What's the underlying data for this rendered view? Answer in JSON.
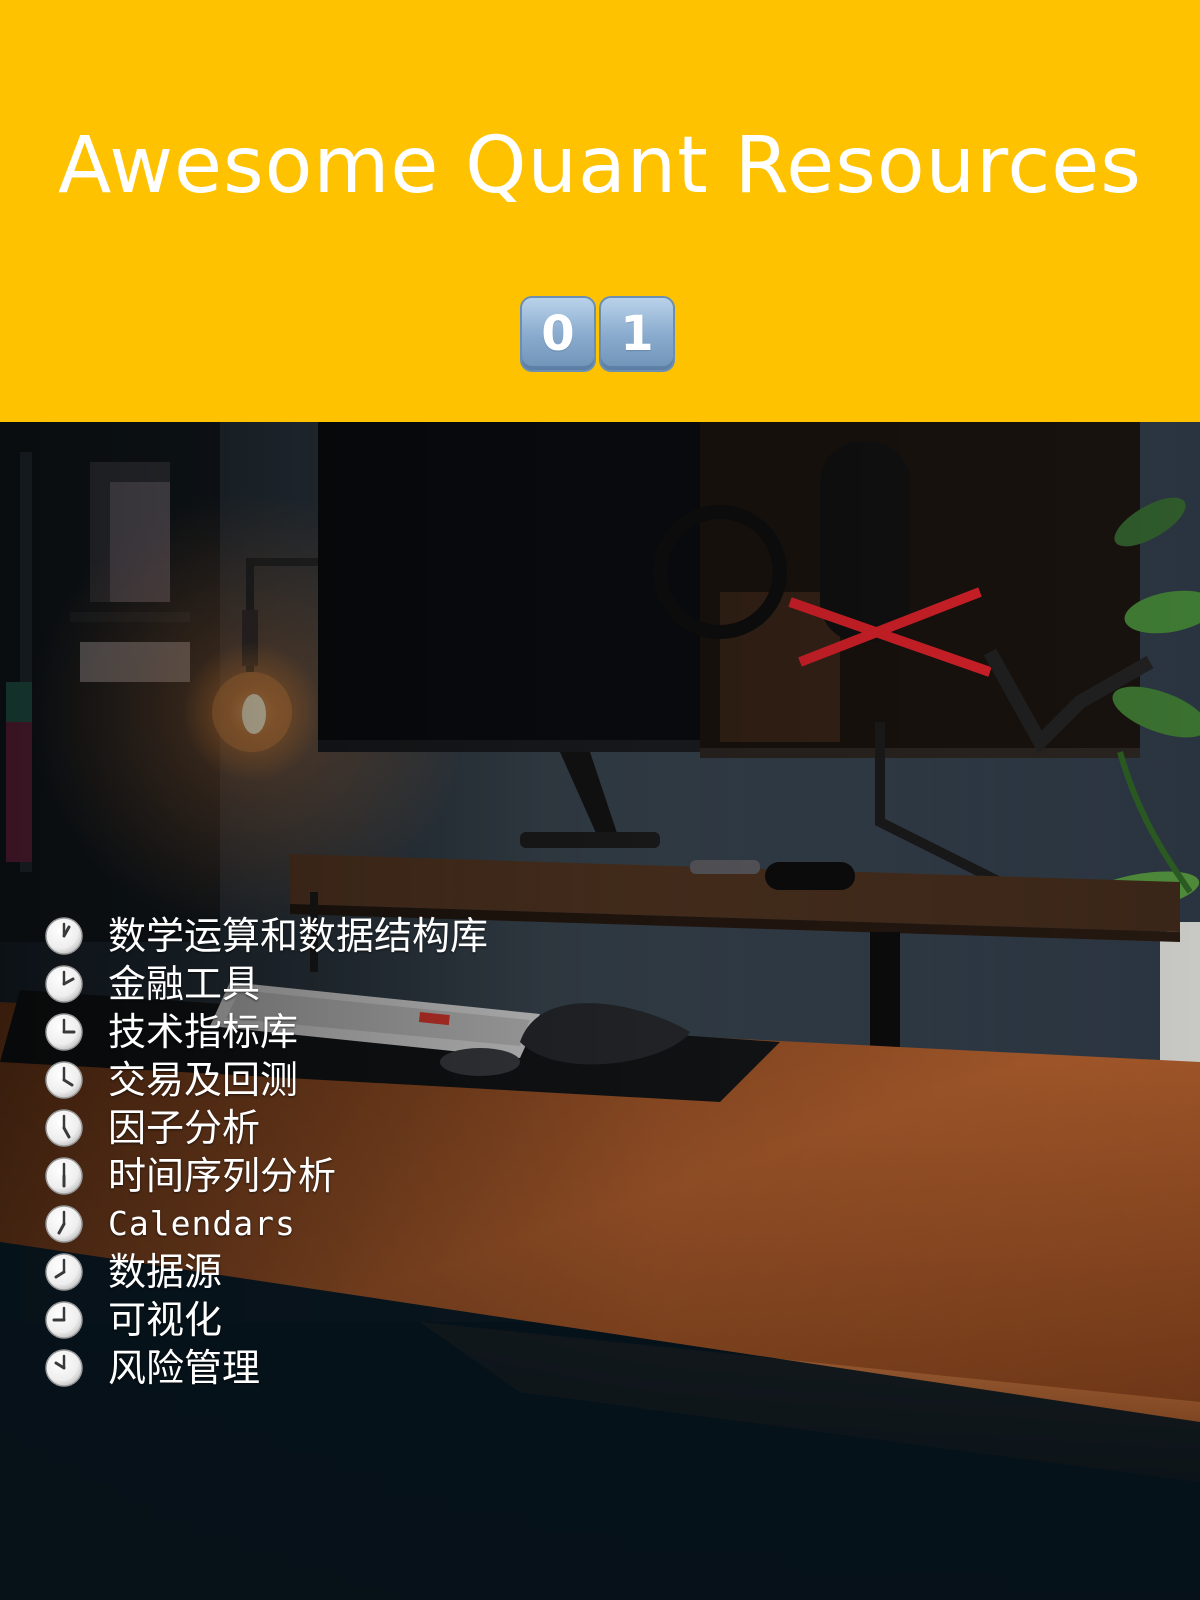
{
  "header": {
    "background_color": "#FFC200",
    "title": "Awesome Quant Resources",
    "badge_digits": [
      "0",
      "1"
    ]
  },
  "topics": [
    {
      "label": "数学运算和数据结构库",
      "icon": "clock-one-icon"
    },
    {
      "label": "金融工具",
      "icon": "clock-two-icon"
    },
    {
      "label": "技术指标库",
      "icon": "clock-three-icon"
    },
    {
      "label": "交易及回测",
      "icon": "clock-four-icon"
    },
    {
      "label": "因子分析",
      "icon": "clock-five-icon"
    },
    {
      "label": "时间序列分析",
      "icon": "clock-six-icon"
    },
    {
      "label": "Calendars",
      "icon": "clock-seven-icon"
    },
    {
      "label": "数据源",
      "icon": "clock-eight-icon"
    },
    {
      "label": "可视化",
      "icon": "clock-nine-icon"
    },
    {
      "label": "风险管理",
      "icon": "clock-ten-icon"
    }
  ]
}
